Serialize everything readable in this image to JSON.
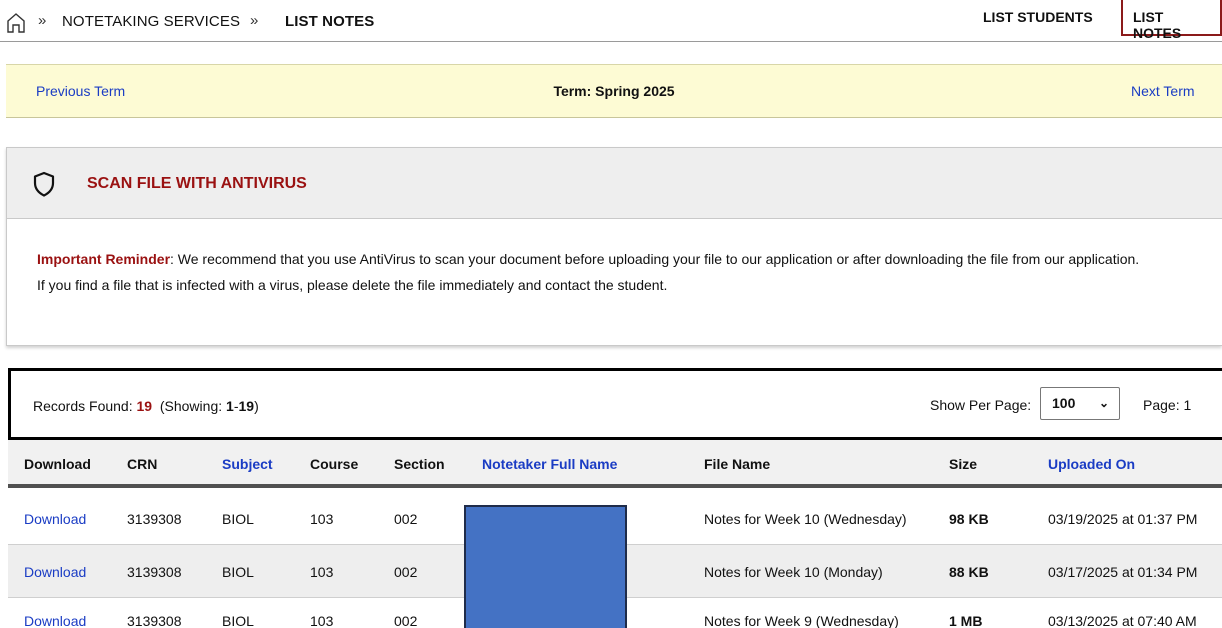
{
  "breadcrumb": {
    "home_icon": "home-icon",
    "separator": "»",
    "items": [
      "NOTETAKING SERVICES",
      "LIST NOTES"
    ]
  },
  "top_tabs": [
    "LIST STUDENTS",
    "LIST NOTES"
  ],
  "term_bar": {
    "previous": "Previous Term",
    "title": "Term: Spring 2025",
    "next": "Next Term"
  },
  "antivirus": {
    "icon": "shield-icon",
    "title": "SCAN FILE WITH ANTIVIRUS",
    "reminder_label": "Important Reminder",
    "reminder_text": ": We recommend that you use AntiVirus to scan your document before uploading your file to our application or after downloading the file from our application.",
    "infected_text": "If you find a file that is infected with a virus, please delete the file immediately and contact the student."
  },
  "records": {
    "found_label": "Records Found:",
    "found_count": "19",
    "showing_label": "(Showing:",
    "showing_from": "1",
    "showing_dash": "-",
    "showing_to": "19",
    "showing_close": ")",
    "per_page_label": "Show Per Page:",
    "per_page_value": "100",
    "page_label": "Page: 1"
  },
  "table": {
    "headers": [
      "Download",
      "CRN",
      "Subject",
      "Course",
      "Section",
      "Notetaker Full Name",
      "File Name",
      "Size",
      "Uploaded On"
    ],
    "rows": [
      {
        "download": "Download",
        "crn": "3139308",
        "subject": "BIOL",
        "course": "103",
        "section": "002",
        "notetaker": "",
        "file": "Notes for Week 10 (Wednesday)",
        "size": "98 KB",
        "uploaded": "03/19/2025 at 01:37 PM"
      },
      {
        "download": "Download",
        "crn": "3139308",
        "subject": "BIOL",
        "course": "103",
        "section": "002",
        "notetaker": "",
        "file": "Notes for Week 10 (Monday)",
        "size": "88 KB",
        "uploaded": "03/17/2025 at 01:34 PM"
      },
      {
        "download": "Download",
        "crn": "3139308",
        "subject": "BIOL",
        "course": "103",
        "section": "002",
        "notetaker": "",
        "file": "Notes for Week 9 (Wednesday)",
        "size": "1 MB",
        "uploaded": "03/13/2025 at 07:40 AM"
      }
    ]
  },
  "colors": {
    "accent_red": "#9a1111",
    "link_blue": "#1a3cc4",
    "term_bar_bg": "#fdfbd4",
    "redaction_blue": "#4472c4"
  }
}
